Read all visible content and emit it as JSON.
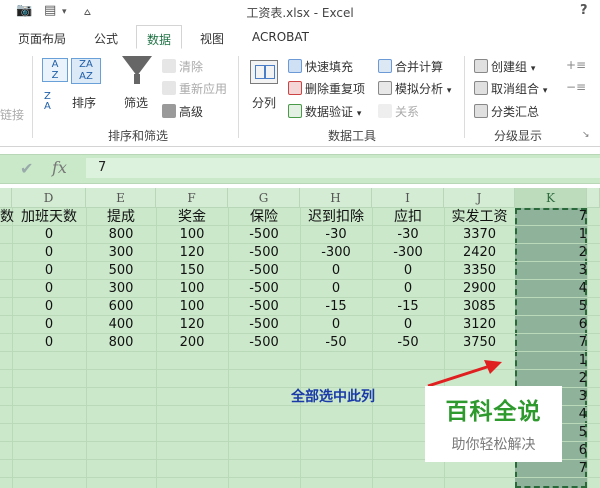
{
  "window": {
    "title": "工资表.xlsx - Excel",
    "help": "?"
  },
  "tabs": [
    "页面布局",
    "公式",
    "数据",
    "视图",
    "ACROBAT"
  ],
  "active_tab": "数据",
  "ribbon": {
    "partial_left": "链接",
    "sort_filter": {
      "sort_label": "排序",
      "filter_label": "筛选",
      "clear_label": "清除",
      "reapply_label": "重新应用",
      "advanced_label": "高级",
      "group_label": "排序和筛选"
    },
    "data_tools": {
      "split_label": "分列",
      "flash_fill_label": "快速填充",
      "remove_dup_label": "删除重复项",
      "validation_label": "数据验证",
      "consolidate_label": "合并计算",
      "whatif_label": "模拟分析",
      "relations_label": "关系",
      "group_label": "数据工具"
    },
    "outline": {
      "group_label_btn": "创建组",
      "ungroup_label": "取消组合",
      "subtotal_label": "分类汇总",
      "group_label": "分级显示"
    }
  },
  "formula_bar": {
    "value": "7",
    "fx": "fx"
  },
  "columns": [
    "D",
    "E",
    "F",
    "G",
    "H",
    "I",
    "J",
    "K"
  ],
  "header_row": {
    "partial": "数",
    "cells": [
      "加班天数",
      "提成",
      "奖金",
      "保险",
      "迟到扣除",
      "应扣",
      "实发工资",
      "7"
    ]
  },
  "rows": [
    [
      "0",
      "800",
      "100",
      "-500",
      "-30",
      "-30",
      "3370",
      "1"
    ],
    [
      "0",
      "300",
      "120",
      "-500",
      "-300",
      "-300",
      "2420",
      "2"
    ],
    [
      "0",
      "500",
      "150",
      "-500",
      "0",
      "0",
      "3350",
      "3"
    ],
    [
      "0",
      "300",
      "100",
      "-500",
      "0",
      "0",
      "2900",
      "4"
    ],
    [
      "0",
      "600",
      "100",
      "-500",
      "-15",
      "-15",
      "3085",
      "5"
    ],
    [
      "0",
      "400",
      "120",
      "-500",
      "0",
      "0",
      "3120",
      "6"
    ],
    [
      "0",
      "800",
      "200",
      "-500",
      "-50",
      "-50",
      "3750",
      "7"
    ]
  ],
  "k_extra": [
    "1",
    "2",
    "3",
    "4",
    "5",
    "6",
    "7"
  ],
  "annotation": "全部选中此列",
  "watermark": {
    "title": "百科全说",
    "subtitle": "助你轻松解决"
  },
  "colors": {
    "accent": "#217346",
    "selection": "#8fb39a",
    "annotation": "#1a3aa8",
    "arrow": "#e02020"
  }
}
